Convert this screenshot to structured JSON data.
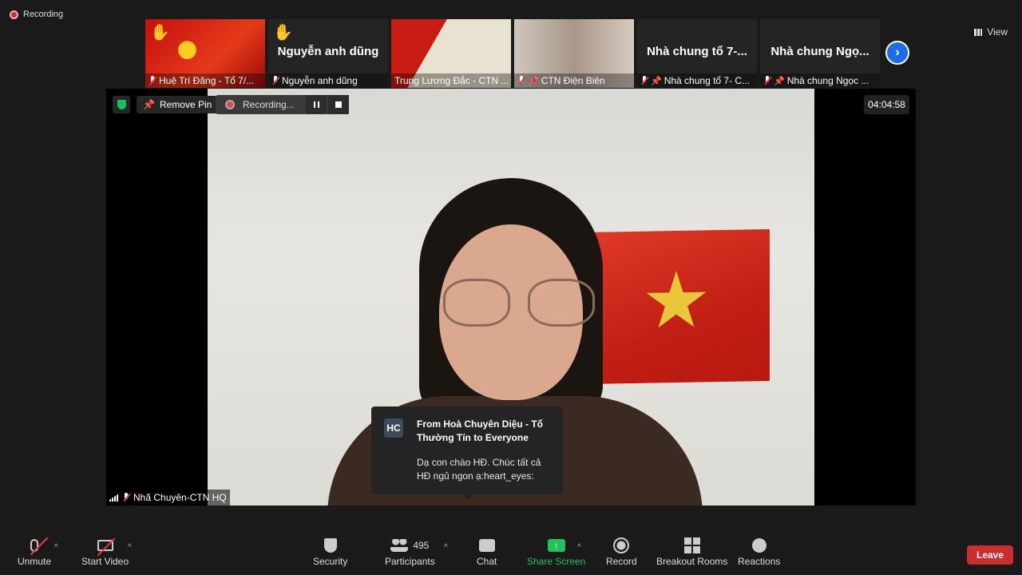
{
  "window": {
    "recording_indicator": "Recording",
    "view_label": "View"
  },
  "strip": {
    "tiles": [
      {
        "name": "Huệ Trí Đăng - Tổ 7/...",
        "big": "",
        "hand": true
      },
      {
        "name": "Nguyễn anh dũng",
        "big": "Nguyễn anh dũng",
        "hand": true
      },
      {
        "name": "Trung Lương Đắc - CTN ...",
        "big": ""
      },
      {
        "name": "CTN Điện Biên",
        "big": ""
      },
      {
        "name": "Nhà chung tổ 7- C...",
        "big": "Nhà chung tổ 7-..."
      },
      {
        "name": "Nhà chung Ngọc ...",
        "big": "Nhà chung Ngọ..."
      }
    ],
    "next_glyph": "›"
  },
  "stage": {
    "remove_pin_label": "Remove Pin",
    "recording_label": "Recording...",
    "timer": "04:04:58",
    "speaker_name": "Nhã Chuyên-CTN HQ"
  },
  "chat_toast": {
    "avatar": "HC",
    "from": "From Hoà Chuyên Diệu - Tổ Thường Tín to Everyone",
    "message": "Dạ con chào HĐ. Chúc tất cả HĐ ngủ ngon ạ:heart_eyes:"
  },
  "toolbar": {
    "unmute": "Unmute",
    "start_video": "Start Video",
    "security": "Security",
    "participants": "Participants",
    "participants_count": "495",
    "chat": "Chat",
    "share_screen": "Share Screen",
    "record": "Record",
    "breakout_rooms": "Breakout Rooms",
    "reactions": "Reactions",
    "leave": "Leave",
    "caret": "^"
  },
  "colors": {
    "share_green": "#21c15c",
    "leave_red": "#c92d2d",
    "accent_blue": "#1f6ce8"
  }
}
